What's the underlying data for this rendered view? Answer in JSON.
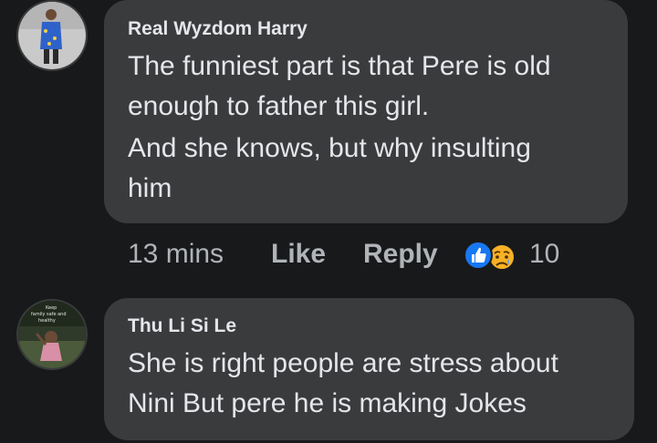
{
  "comments": [
    {
      "author": "Real Wyzdom Harry",
      "lines": [
        "The funniest part is that Pere is old",
        "enough to father this girl.",
        "And she knows, but why insulting",
        "him"
      ],
      "time": "13 mins",
      "like_label": "Like",
      "reply_label": "Reply",
      "reactions": [
        "like-icon",
        "sad-icon"
      ],
      "reaction_count": "10"
    },
    {
      "author": "Thu Li Si Le",
      "avatar_caption": [
        "Keep",
        "family safe and",
        "healthy"
      ],
      "lines": [
        "She is right people are stress about",
        "Nini But pere he is making Jokes"
      ]
    }
  ],
  "colors": {
    "background": "#18191a",
    "bubble": "#3a3b3c",
    "text": "#e4e6eb",
    "secondary_text": "#b0b3b8",
    "like_blue": "#1877f2",
    "sad_yellow": "#f7b125"
  }
}
